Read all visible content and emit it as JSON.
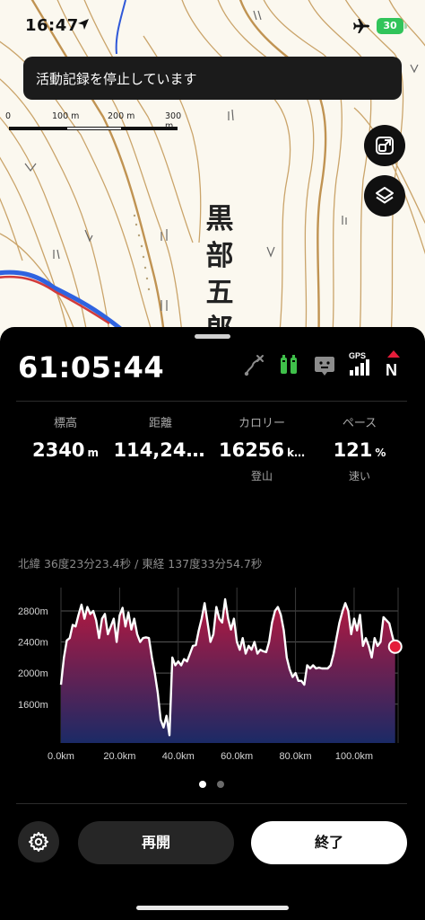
{
  "status_bar": {
    "time": "16:47",
    "battery": "30"
  },
  "toast": {
    "message": "活動記録を停止しています"
  },
  "map": {
    "scale_labels": [
      "0",
      "100 m",
      "200 m",
      "300 m"
    ],
    "peak_name": [
      "黒",
      "部",
      "五",
      "郎"
    ],
    "icons": [
      "layers-fit-icon",
      "layers-icon"
    ]
  },
  "activity": {
    "elapsed": "61:05:44",
    "status_icons": [
      "route-icon",
      "battery-pair-icon",
      "network-status-icon",
      "gps-signal-icon",
      "compass-north-icon"
    ],
    "gps_label": "GPS",
    "north_label": "N",
    "stats": [
      {
        "label": "標高",
        "value": "2340",
        "unit": "m",
        "sub": ""
      },
      {
        "label": "距離",
        "value": "114,24…",
        "unit": "",
        "sub": ""
      },
      {
        "label": "カロリー",
        "value": "16256",
        "unit": "k…",
        "sub": "登山"
      },
      {
        "label": "ペース",
        "value": "121",
        "unit": "%",
        "sub": "速い"
      }
    ],
    "coordinates": "北緯 36度23分23.4秒 / 東経 137度33分54.7秒"
  },
  "chart_data": {
    "type": "area",
    "title": "",
    "xlabel": "",
    "ylabel": "",
    "x_ticks": [
      "0.0km",
      "20.0km",
      "40.0km",
      "60.0km",
      "80.0km",
      "100.0km"
    ],
    "y_ticks": [
      "1600m",
      "2000m",
      "2400m",
      "2800m"
    ],
    "xlim": [
      0,
      115
    ],
    "ylim": [
      1100,
      3100
    ],
    "x": [
      0,
      1,
      2,
      3,
      4,
      5,
      6,
      7,
      8,
      9,
      10,
      11,
      12,
      13,
      14,
      15,
      16,
      17,
      18,
      19,
      20,
      21,
      22,
      23,
      24,
      25,
      26,
      27,
      28,
      29,
      30,
      31,
      32,
      33,
      34,
      35,
      36,
      37,
      38,
      39,
      40,
      41,
      42,
      43,
      44,
      45,
      46,
      47,
      48,
      49,
      50,
      51,
      52,
      53,
      54,
      55,
      56,
      57,
      58,
      59,
      60,
      61,
      62,
      63,
      64,
      65,
      66,
      67,
      68,
      69,
      70,
      71,
      72,
      73,
      74,
      75,
      76,
      77,
      78,
      79,
      80,
      81,
      82,
      83,
      84,
      85,
      86,
      87,
      88,
      89,
      90,
      91,
      92,
      93,
      94,
      95,
      96,
      97,
      98,
      99,
      100,
      101,
      102,
      103,
      104,
      105,
      106,
      107,
      108,
      109,
      110,
      111,
      112,
      113,
      114
    ],
    "y": [
      1850,
      2200,
      2420,
      2450,
      2620,
      2600,
      2750,
      2880,
      2700,
      2850,
      2760,
      2800,
      2680,
      2450,
      2700,
      2760,
      2500,
      2600,
      2700,
      2400,
      2740,
      2840,
      2600,
      2780,
      2560,
      2700,
      2500,
      2400,
      2450,
      2460,
      2450,
      2200,
      2000,
      1750,
      1400,
      1300,
      1450,
      1200,
      2200,
      2100,
      2150,
      2100,
      2180,
      2150,
      2250,
      2350,
      2360,
      2550,
      2700,
      2900,
      2650,
      2400,
      2500,
      2850,
      2700,
      2650,
      2950,
      2700,
      2560,
      2700,
      2400,
      2300,
      2450,
      2250,
      2350,
      2300,
      2400,
      2250,
      2300,
      2280,
      2270,
      2400,
      2650,
      2800,
      2850,
      2750,
      2550,
      2200,
      2050,
      1950,
      2000,
      1900,
      1900,
      1850,
      2100,
      2060,
      2100,
      2060,
      2070,
      2060,
      2060,
      2060,
      2100,
      2250,
      2450,
      2650,
      2790,
      2900,
      2800,
      2500,
      2700,
      2550,
      2750,
      2350,
      2450,
      2350,
      2200,
      2450,
      2350,
      2400,
      2720,
      2680,
      2640,
      2480,
      2340
    ],
    "series_color_top": "#b5183f",
    "series_color_bottom": "#1b2a66",
    "current_marker_color": "#e41d3a"
  },
  "controls": {
    "resume_label": "再開",
    "end_label": "終了"
  },
  "colors": {
    "panel_bg": "#000000",
    "accent_green": "#31c45a",
    "accent_red": "#e41d3a"
  }
}
